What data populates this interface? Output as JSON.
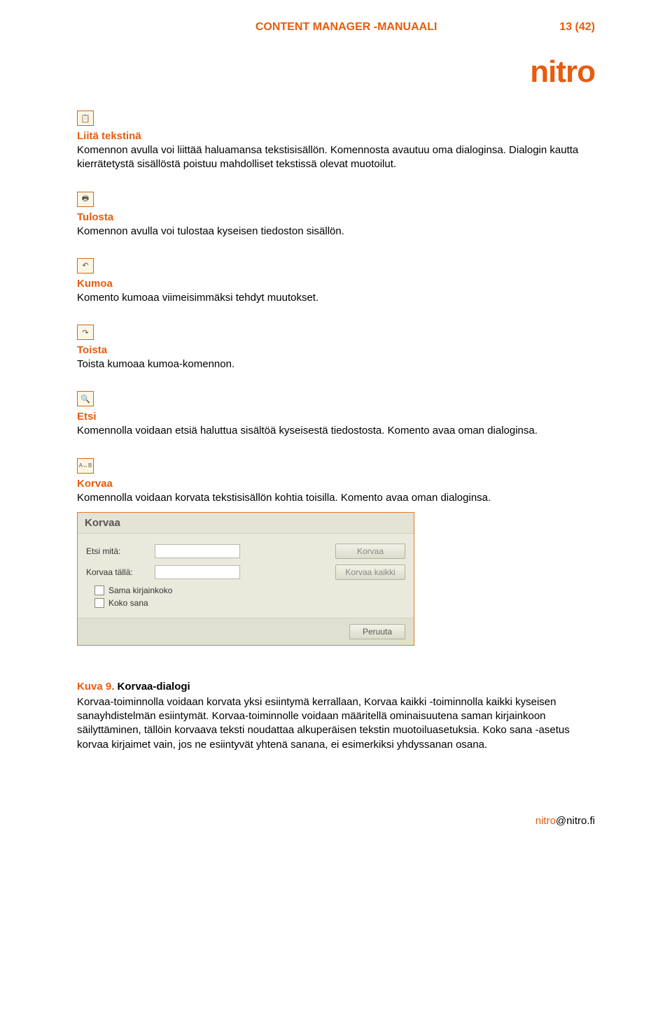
{
  "header": {
    "title": "CONTENT MANAGER -MANUAALI",
    "page": "13 (42)"
  },
  "logo": "nitro",
  "sections": {
    "paste_text": {
      "icon": "paste-text-icon",
      "glyph": "📋",
      "title": "Liitä tekstinä",
      "body": "Komennon avulla voi liittää haluamansa tekstisisällön. Komennosta avautuu oma dialoginsa. Dialogin kautta kierrätetystä sisällöstä poistuu mahdolliset tekstissä olevat muotoilut."
    },
    "print": {
      "icon": "print-icon",
      "glyph": "🖶",
      "title": "Tulosta",
      "body": "Komennon avulla voi tulostaa kyseisen tiedoston sisällön."
    },
    "undo": {
      "icon": "undo-icon",
      "glyph": "↶",
      "title": "Kumoa",
      "body": "Komento kumoaa viimeisimmäksi tehdyt muutokset."
    },
    "redo": {
      "icon": "redo-icon",
      "glyph": "↷",
      "title": "Toista",
      "body": "Toista kumoaa kumoa-komennon."
    },
    "find": {
      "icon": "find-icon",
      "glyph": "🔍",
      "title": "Etsi",
      "body": "Komennolla voidaan etsiä haluttua sisältöä kyseisestä tiedostosta. Komento avaa oman dialoginsa."
    },
    "replace": {
      "icon": "replace-icon",
      "glyph": "A↔B",
      "title": "Korvaa",
      "body": "Komennolla voidaan korvata tekstisisällön kohtia toisilla. Komento avaa oman dialoginsa."
    }
  },
  "dialog": {
    "title": "Korvaa",
    "find_label": "Etsi mitä:",
    "replace_label": "Korvaa tällä:",
    "btn_replace": "Korvaa",
    "btn_replace_all": "Korvaa kaikki",
    "chk_case": "Sama kirjainkoko",
    "chk_whole": "Koko sana",
    "btn_cancel": "Peruuta"
  },
  "caption": {
    "prefix": "Kuva 9.",
    "rest": " Korvaa-dialogi"
  },
  "paragraph": "Korvaa-toiminnolla voidaan korvata yksi esiintymä kerrallaan, Korvaa kaikki -toiminnolla kaikki kyseisen sanayhdistelmän esiintymät. Korvaa-toiminnolle voidaan määritellä ominaisuutena saman kirjainkoon säilyttäminen, tällöin korvaava teksti noudattaa alkuperäisen tekstin muotoiluasetuksia. Koko sana -asetus korvaa kirjaimet vain, jos ne esiintyvät yhtenä sanana, ei esimerkiksi yhdyssanan osana.",
  "footer": {
    "email_user": "nitro",
    "email_domain": "@nitro.fi"
  }
}
